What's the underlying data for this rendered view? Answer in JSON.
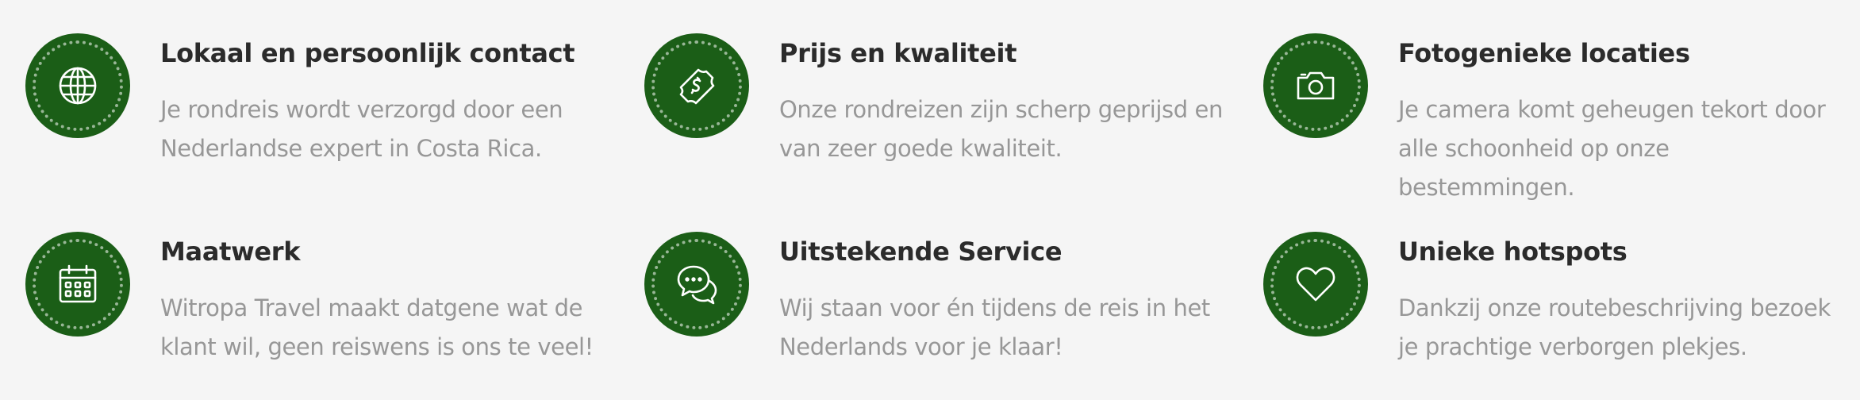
{
  "colors": {
    "background": "#f5f5f5",
    "icon_circle": "#1b5e17",
    "title": "#2b2b2b",
    "text": "#979797"
  },
  "features": [
    {
      "icon": "globe-icon",
      "title": "Lokaal en persoonlijk contact",
      "text": "Je rondreis wordt verzorgd door een Nederlandse expert in Costa Rica."
    },
    {
      "icon": "money-icon",
      "title": "Prijs en kwaliteit",
      "text": "Onze rondreizen zijn scherp geprijsd en van zeer goede kwaliteit."
    },
    {
      "icon": "camera-icon",
      "title": "Fotogenieke locaties",
      "text": "Je camera komt geheugen tekort door alle schoonheid op onze bestemmingen."
    },
    {
      "icon": "calendar-icon",
      "title": "Maatwerk",
      "text": "Witropa Travel maakt datgene wat de klant wil, geen reiswens is ons te veel!"
    },
    {
      "icon": "chat-icon",
      "title": "Uitstekende Service",
      "text": "Wij staan voor én tijdens de reis in het Nederlands voor je klaar!"
    },
    {
      "icon": "heart-icon",
      "title": "Unieke hotspots",
      "text": "Dankzij onze routebeschrijving bezoek je prachtige verborgen plekjes."
    }
  ]
}
